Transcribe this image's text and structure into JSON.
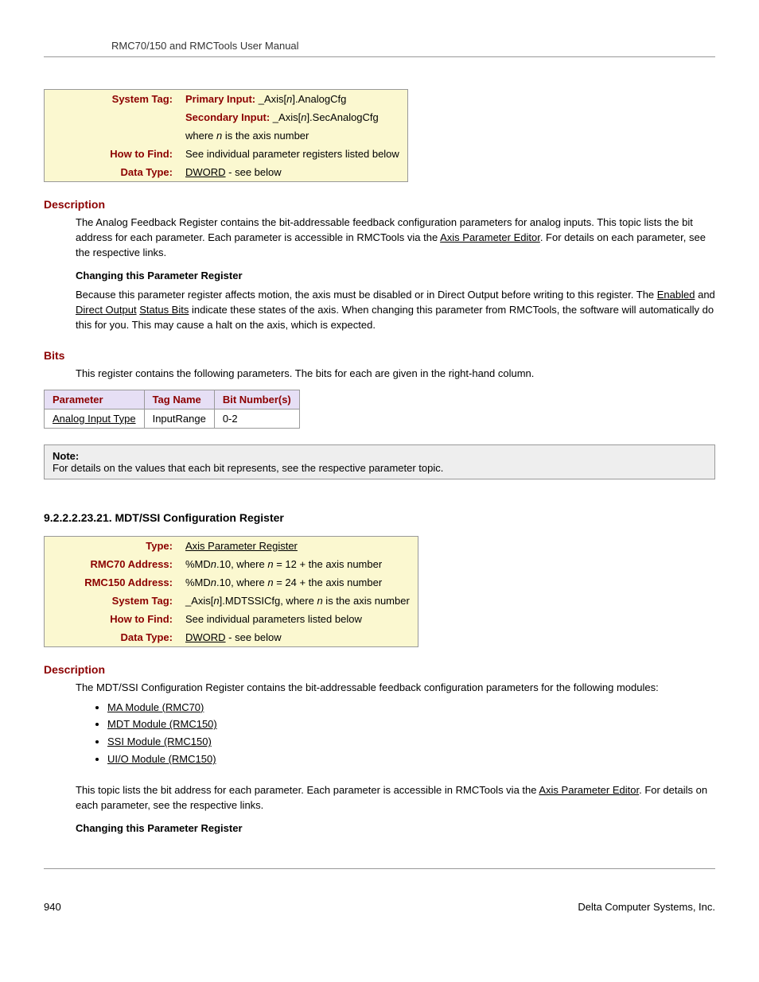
{
  "header": "RMC70/150 and RMCTools User Manual",
  "info1": {
    "rows": [
      {
        "label": "System Tag:",
        "primary_label": "Primary Input:",
        "primary_val": " _Axis[",
        "primary_n": "n",
        "primary_suffix": "].AnalogCfg",
        "secondary_label": "Secondary Input:",
        "secondary_val": " _Axis[",
        "secondary_n": "n",
        "secondary_suffix": "].SecAnalogCfg",
        "where_prefix": "where ",
        "where_n": "n",
        "where_suffix": " is the axis number"
      },
      {
        "label": "How to Find:",
        "value": "See individual parameter registers listed below"
      },
      {
        "label": "Data Type:",
        "link": "DWORD",
        "suffix": " - see below"
      }
    ]
  },
  "desc1": {
    "heading": "Description",
    "p1a": "The Analog Feedback Register contains the bit-addressable feedback configuration parameters for analog inputs. This topic lists the bit address for each parameter. Each parameter is accessible in RMCTools via the ",
    "p1link": "Axis Parameter Editor",
    "p1b": ". For details on each parameter, see the respective links.",
    "sub": "Changing this Parameter Register",
    "p2a": "Because this parameter register affects motion, the axis must be disabled or in Direct Output before writing to this register. The ",
    "p2link1": "Enabled",
    "p2mid1": " and ",
    "p2link2": "Direct Output",
    "p2mid2": " ",
    "p2link3": "Status Bits",
    "p2b": " indicate these states of the axis. When changing this parameter from RMCTools, the software will automatically do this for you. This may cause a halt on the axis, which is expected."
  },
  "bits": {
    "heading": "Bits",
    "intro": "This register contains the following parameters. The bits for each are given in the right-hand column.",
    "cols": [
      "Parameter",
      "Tag Name",
      "Bit Number(s)"
    ],
    "rows": [
      {
        "param": "Analog Input Type",
        "tag": "InputRange",
        "bits": "0-2"
      }
    ],
    "chart_data": {
      "type": "table",
      "columns": [
        "Parameter",
        "Tag Name",
        "Bit Number(s)"
      ],
      "rows": [
        [
          "Analog Input Type",
          "InputRange",
          "0-2"
        ]
      ]
    }
  },
  "note": {
    "title": "Note:",
    "text": "For details on the values that each bit represents, see the respective parameter topic."
  },
  "section2": {
    "number": "9.2.2.2.23.21. MDT/SSI Configuration Register"
  },
  "info2": {
    "type_label": "Type:",
    "type_link": "Axis Parameter Register",
    "rmc70_label": "RMC70 Address:",
    "rmc70_a": "%MD",
    "rmc70_n1": "n",
    "rmc70_b": ".10, where ",
    "rmc70_n2": "n",
    "rmc70_c": " = 12 + the axis number",
    "rmc150_label": "RMC150 Address:",
    "rmc150_a": "%MD",
    "rmc150_n1": "n",
    "rmc150_b": ".10, where ",
    "rmc150_n2": "n",
    "rmc150_c": " = 24 + the axis number",
    "systag_label": "System Tag:",
    "systag_a": "_Axis[",
    "systag_n1": "n",
    "systag_b": "].MDTSSICfg, where ",
    "systag_n2": "n",
    "systag_c": " is the axis number",
    "howto_label": "How to Find:",
    "howto_val": "See individual parameters listed below",
    "dtype_label": "Data Type:",
    "dtype_link": "DWORD",
    "dtype_suffix": " - see below"
  },
  "desc2": {
    "heading": "Description",
    "p1": "The MDT/SSI Configuration Register contains the bit-addressable feedback configuration parameters for the following modules:",
    "modules": [
      "MA Module (RMC70)",
      "MDT Module (RMC150)",
      "SSI Module (RMC150)",
      "UI/O Module (RMC150)"
    ],
    "p2a": "This topic lists the bit address for each parameter. Each parameter is accessible in RMCTools via the ",
    "p2link": "Axis Parameter Editor",
    "p2b": ". For details on each parameter, see the respective links.",
    "sub": "Changing this Parameter Register"
  },
  "footer": {
    "page": "940",
    "company": "Delta Computer Systems, Inc."
  }
}
